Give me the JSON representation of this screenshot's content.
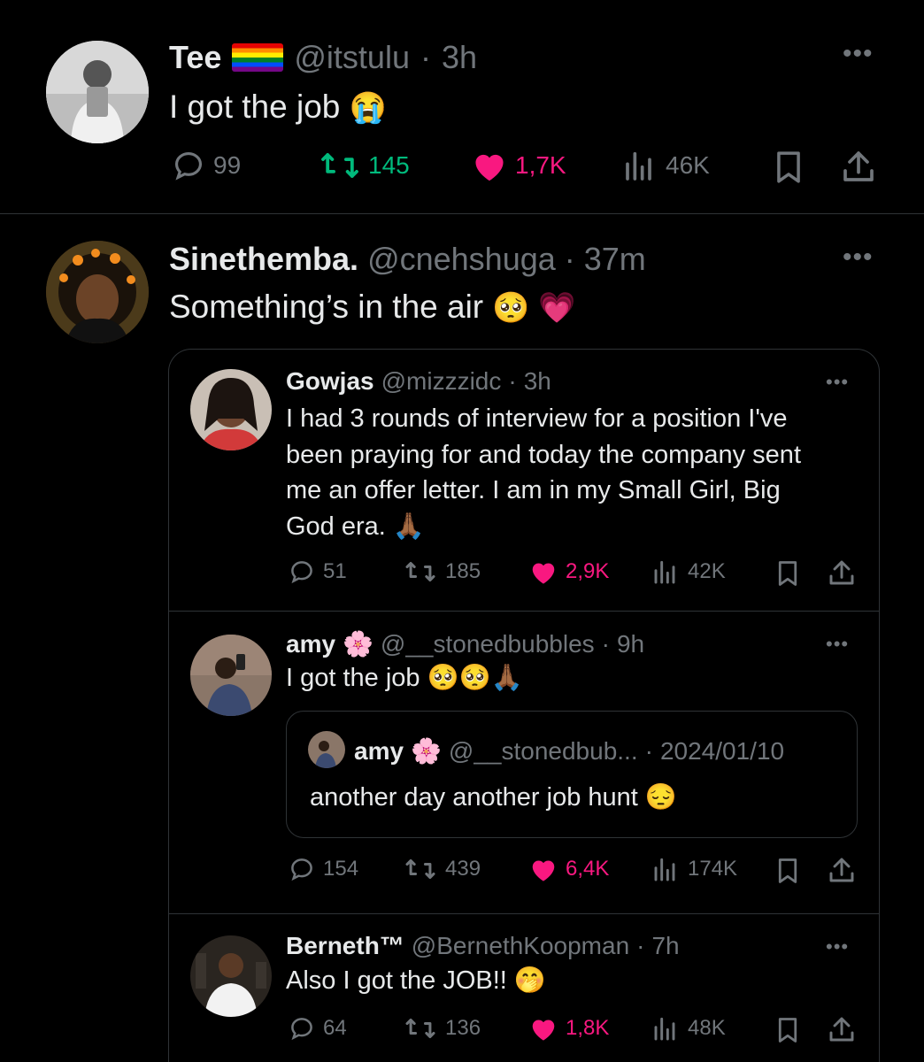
{
  "tweets": {
    "t1": {
      "name": "Tee",
      "flag": "🏳️‍🌈",
      "handle": "@itstulu",
      "time": "3h",
      "text": "I got the job",
      "emoji": "😭",
      "replies": "99",
      "retweets": "145",
      "likes": "1,7K",
      "views": "46K"
    },
    "t2": {
      "name": "Sinethemba.",
      "handle": "@cnehshuga",
      "time": "37m",
      "text": "Something’s in the air",
      "emoji": "🥺 💗"
    }
  },
  "embedded": {
    "e1": {
      "name": "Gowjas",
      "handle": "@mizzzidc",
      "time": "3h",
      "lines": [
        "I had 3 rounds of interview for a position I've",
        "been praying for and today the company sent",
        "me an offer letter. I am in my Small Girl, Big",
        "God era."
      ],
      "emoji": "🙏🏾",
      "replies": "51",
      "retweets": "185",
      "likes": "2,9K",
      "views": "42K"
    },
    "e2": {
      "name": "amy",
      "flower": "🌸",
      "handle": "@__stonedbubbles",
      "time": "9h",
      "text": "I got the job",
      "emoji": "🥺🥺🙏🏾",
      "quote": {
        "name": "amy",
        "flower": "🌸",
        "handle": "@__stonedbub...",
        "time": "2024/01/10",
        "text": "another day another job hunt",
        "emoji": "😔"
      },
      "replies": "154",
      "retweets": "439",
      "likes": "6,4K",
      "views": "174K"
    },
    "e3": {
      "name": "Berneth™",
      "handle": "@BernethKoopman",
      "time": "7h",
      "text": "Also I got the JOB!!",
      "emoji": "🤭",
      "replies": "64",
      "retweets": "136",
      "likes": "1,8K",
      "views": "48K"
    }
  },
  "colors": {
    "background": "#000000",
    "text": "#e7e9ea",
    "muted": "#71767b",
    "retweet": "#00ba7c",
    "like": "#f91880",
    "border": "#2f3336"
  }
}
